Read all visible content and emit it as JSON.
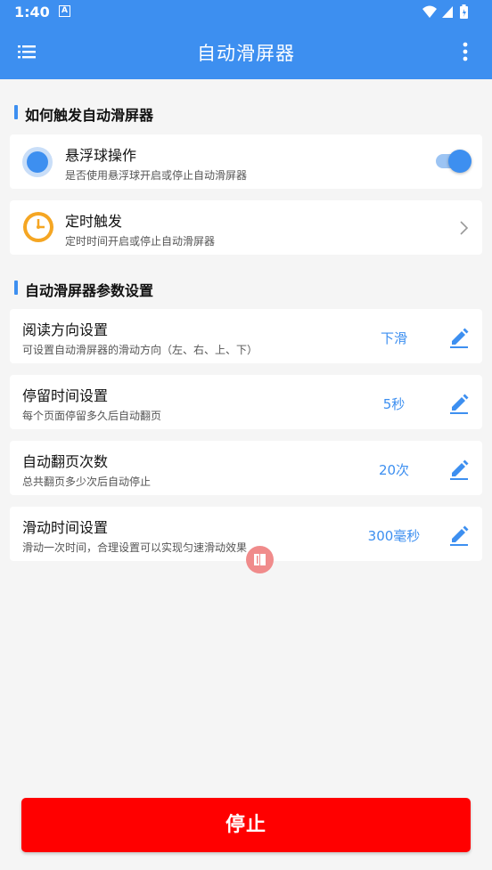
{
  "status_bar": {
    "time": "1:40",
    "notification_icon": "A",
    "icons": [
      "wifi-icon",
      "signal-icon",
      "battery-icon"
    ]
  },
  "app_bar": {
    "title": "自动滑屏器",
    "menu_icon": "list-icon",
    "more_icon": "more-vert-icon"
  },
  "section_trigger": {
    "title": "如何触发自动滑屏器",
    "items": [
      {
        "title": "悬浮球操作",
        "subtitle": "是否使用悬浮球开启或停止自动滑屏器",
        "toggle_on": true
      },
      {
        "title": "定时触发",
        "subtitle": "定时时间开启或停止自动滑屏器"
      }
    ]
  },
  "section_params": {
    "title": "自动滑屏器参数设置",
    "items": [
      {
        "title": "阅读方向设置",
        "subtitle": "可设置自动滑屏器的滑动方向（左、右、上、下）",
        "value": "下滑"
      },
      {
        "title": "停留时间设置",
        "subtitle": "每个页面停留多久后自动翻页",
        "value": "5秒"
      },
      {
        "title": "自动翻页次数",
        "subtitle": "总共翻页多少次后自动停止",
        "value": "20次"
      },
      {
        "title": "滑动时间设置",
        "subtitle": "滑动一次时间，合理设置可以实现匀速滑动效果",
        "value": "300毫秒"
      }
    ]
  },
  "stop_button": {
    "label": "停止"
  },
  "colors": {
    "primary": "#3d8ff0",
    "stop": "#ff0000",
    "background": "#f5f5f5",
    "clock": "#f5a623"
  }
}
